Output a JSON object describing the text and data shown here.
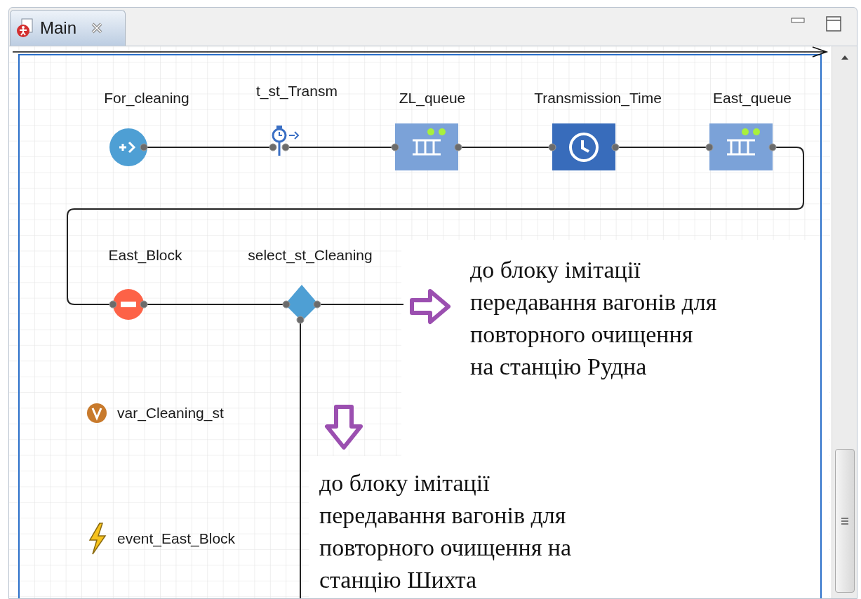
{
  "tab": {
    "label": "Main",
    "selected": true
  },
  "nodes": [
    {
      "kind": "source",
      "label": "For_cleaning"
    },
    {
      "kind": "time-measure",
      "label": "t_st_Transm"
    },
    {
      "kind": "queue",
      "label": "ZL_queue"
    },
    {
      "kind": "delay",
      "label": "Transmission_Time"
    },
    {
      "kind": "queue",
      "label": "East_queue"
    },
    {
      "kind": "hold",
      "label": "East_Block"
    },
    {
      "kind": "select-output",
      "label": "select_st_Cleaning"
    }
  ],
  "elements": [
    {
      "kind": "variable",
      "label": "var_Cleaning_st"
    },
    {
      "kind": "event",
      "label": "event_East_Block"
    }
  ],
  "notes": [
    {
      "kind": "right",
      "lines": [
        "до блоку імітації",
        "передавання вагонів для",
        "повторного очищення",
        "на станцію Рудна"
      ]
    },
    {
      "kind": "down",
      "lines": [
        "до блоку імітації",
        "передавання вагонів для",
        "повторного очищення на",
        "станцію Шихта"
      ]
    }
  ]
}
